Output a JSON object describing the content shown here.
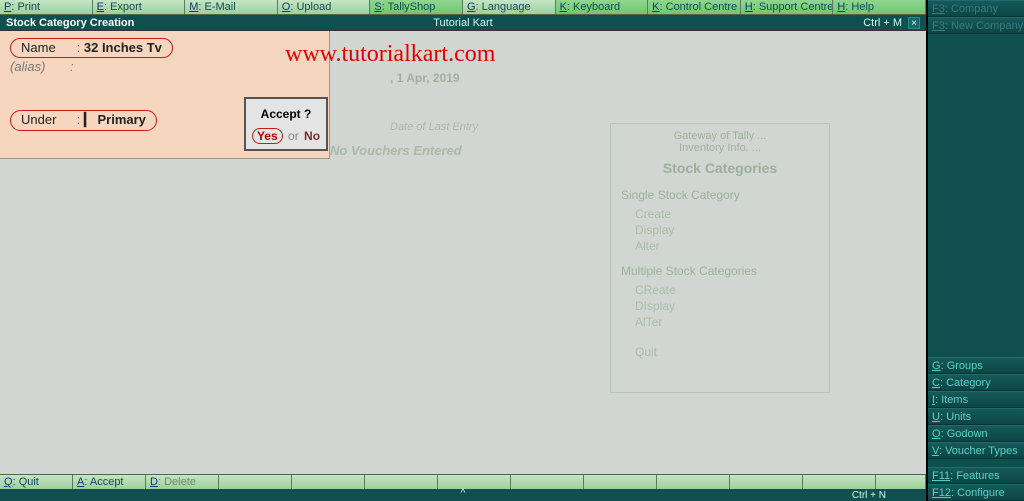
{
  "top_toolbar": [
    {
      "key": "P",
      "label": "Print"
    },
    {
      "key": "E",
      "label": "Export"
    },
    {
      "key": "M",
      "label": "E-Mail"
    },
    {
      "key": "O",
      "label": "Upload"
    },
    {
      "key": "S",
      "label": "TallyShop"
    },
    {
      "key": "G",
      "label": "Language"
    },
    {
      "key": "K",
      "label": "Keyboard"
    },
    {
      "key": "K",
      "label": "Control Centre"
    },
    {
      "key": "H",
      "label": "Support Centre"
    },
    {
      "key": "H",
      "label": "Help"
    }
  ],
  "titlebar": {
    "left": "Stock Category Creation",
    "center": "Tutorial Kart",
    "right": "Ctrl + M"
  },
  "form": {
    "name_label": "Name",
    "name_value": "32 Inches Tv",
    "alias_label": "(alias)",
    "under_label": "Under",
    "under_value": "Primary"
  },
  "accept": {
    "title": "Accept ?",
    "yes": "Yes",
    "sep": "or",
    "no": "No"
  },
  "watermark": "www.tutorialkart.com",
  "bg": {
    "date": ", 1 Apr, 2019",
    "last_entry_label": "Date of Last Entry",
    "no_vouchers": "No Vouchers Entered"
  },
  "gateway": {
    "hdr1": "Gateway of Tally ...",
    "hdr2": "Inventory Info. ...",
    "title": "Stock Categories",
    "section1": "Single Stock Category",
    "items1": [
      "Create",
      "Display",
      "Alter"
    ],
    "section2": "Multiple Stock Categories",
    "items2": [
      "CReate",
      "DIsplay",
      "AlTer"
    ],
    "quit": "Quit"
  },
  "bottom_toolbar": [
    {
      "key": "Q",
      "label": "Quit"
    },
    {
      "key": "A",
      "label": "Accept"
    },
    {
      "key": "D",
      "label": "Delete",
      "dim": true
    }
  ],
  "statusbar": {
    "right": "Ctrl + N",
    "caret": "^"
  },
  "right_bar_top": [
    {
      "key": "F3",
      "label": "Company",
      "dim": true
    },
    {
      "key": "F3",
      "label": "New Company",
      "dim": true
    }
  ],
  "right_bar_bottom": [
    {
      "key": "G",
      "label": "Groups"
    },
    {
      "key": "C",
      "label": "Category"
    },
    {
      "key": "I",
      "label": "Items"
    },
    {
      "key": "U",
      "label": "Units"
    },
    {
      "key": "O",
      "label": "Godown"
    },
    {
      "key": "V",
      "label": "Voucher Types"
    },
    {
      "key": "F11",
      "label": "Features"
    },
    {
      "key": "F12",
      "label": "Configure"
    }
  ]
}
